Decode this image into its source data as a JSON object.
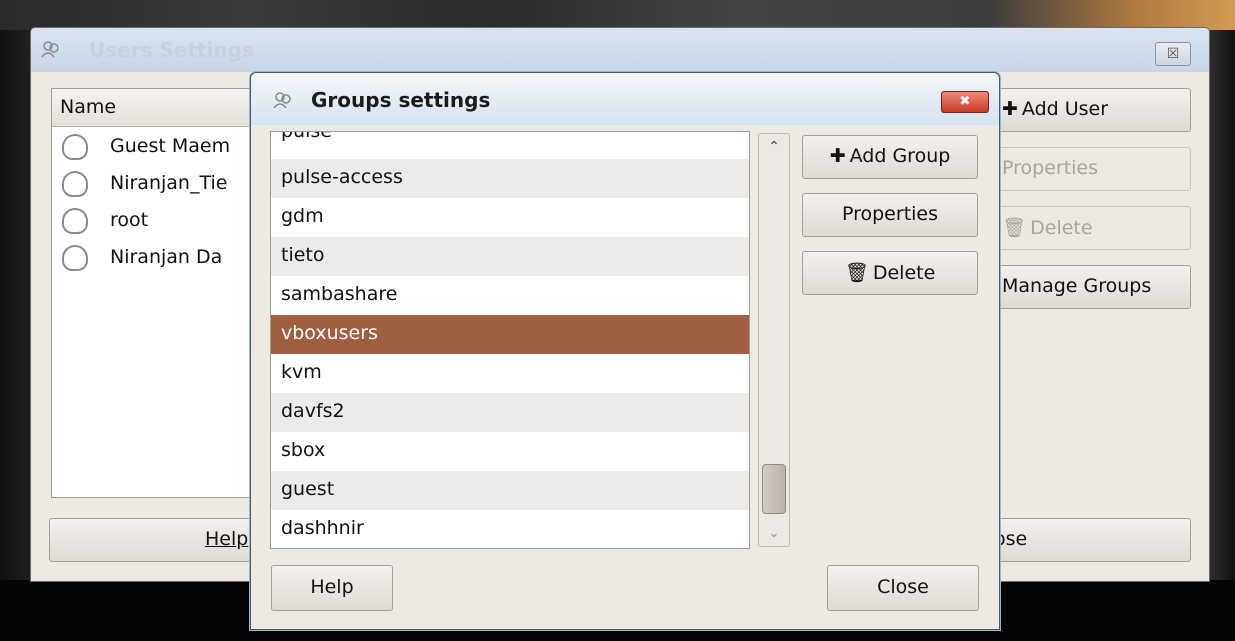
{
  "users_window": {
    "title": "Users Settings",
    "close_glyph": "☒",
    "list_header": "Name",
    "users": [
      "Guest Maem",
      "Niranjan_Tie",
      "root",
      "Niranjan Da"
    ],
    "help_label": "Help",
    "buttons": {
      "add_user": "Add User",
      "properties": "Properties",
      "delete": "Delete",
      "manage_groups": "Manage Groups"
    },
    "close_label": "ose"
  },
  "groups_window": {
    "title": "Groups settings",
    "close_glyph": "✖",
    "groups": [
      "pulse",
      "pulse-access",
      "gdm",
      "tieto",
      "sambashare",
      "vboxusers",
      "kvm",
      "davfs2",
      "sbox",
      "guest",
      "dashhnir"
    ],
    "selected_group": "vboxusers",
    "scroll_up_glyph": "⌃",
    "scroll_down_glyph": "⌄",
    "buttons": {
      "add_group": "Add Group",
      "properties": "Properties",
      "delete": "Delete"
    },
    "help_label": "Help",
    "close_label": "Close"
  },
  "colors": {
    "selection": "#a05f40",
    "window_bg": "#ede9e3",
    "titlebar": "#d6e2ee"
  },
  "icons": {
    "window": "users-icon",
    "add": "plus-icon",
    "delete": "trash-icon",
    "user": "person-icon"
  }
}
